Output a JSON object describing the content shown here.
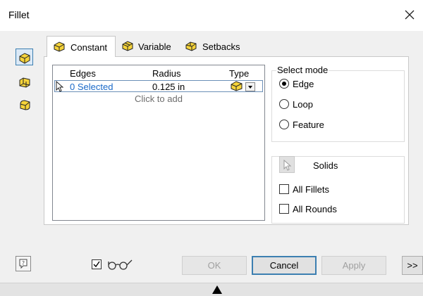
{
  "window": {
    "title": "Fillet"
  },
  "tabs": [
    {
      "label": "Constant",
      "icon": "constant-fillet-icon"
    },
    {
      "label": "Variable",
      "icon": "variable-fillet-icon"
    },
    {
      "label": "Setbacks",
      "icon": "setbacks-fillet-icon"
    }
  ],
  "sidebar": {
    "buttons": [
      "edge-fillet-icon",
      "face-fillet-icon",
      "full-round-fillet-icon"
    ]
  },
  "grid": {
    "headers": {
      "edges": "Edges",
      "radius": "Radius",
      "type": "Type"
    },
    "row": {
      "edges": "0 Selected",
      "radius": "0.125 in"
    },
    "add_text": "Click to add"
  },
  "select_mode": {
    "label": "Select mode",
    "options": [
      "Edge",
      "Loop",
      "Feature"
    ],
    "selected": "Edge"
  },
  "solids": {
    "label": "Solids"
  },
  "checkboxes": {
    "all_fillets": "All Fillets",
    "all_rounds": "All Rounds"
  },
  "buttons": {
    "ok": "OK",
    "cancel": "Cancel",
    "apply": "Apply",
    "more": ">>"
  },
  "colors": {
    "accent": "#3c7fb1",
    "link": "#1a6ac9",
    "icon_yellow": "#f5d33a"
  }
}
